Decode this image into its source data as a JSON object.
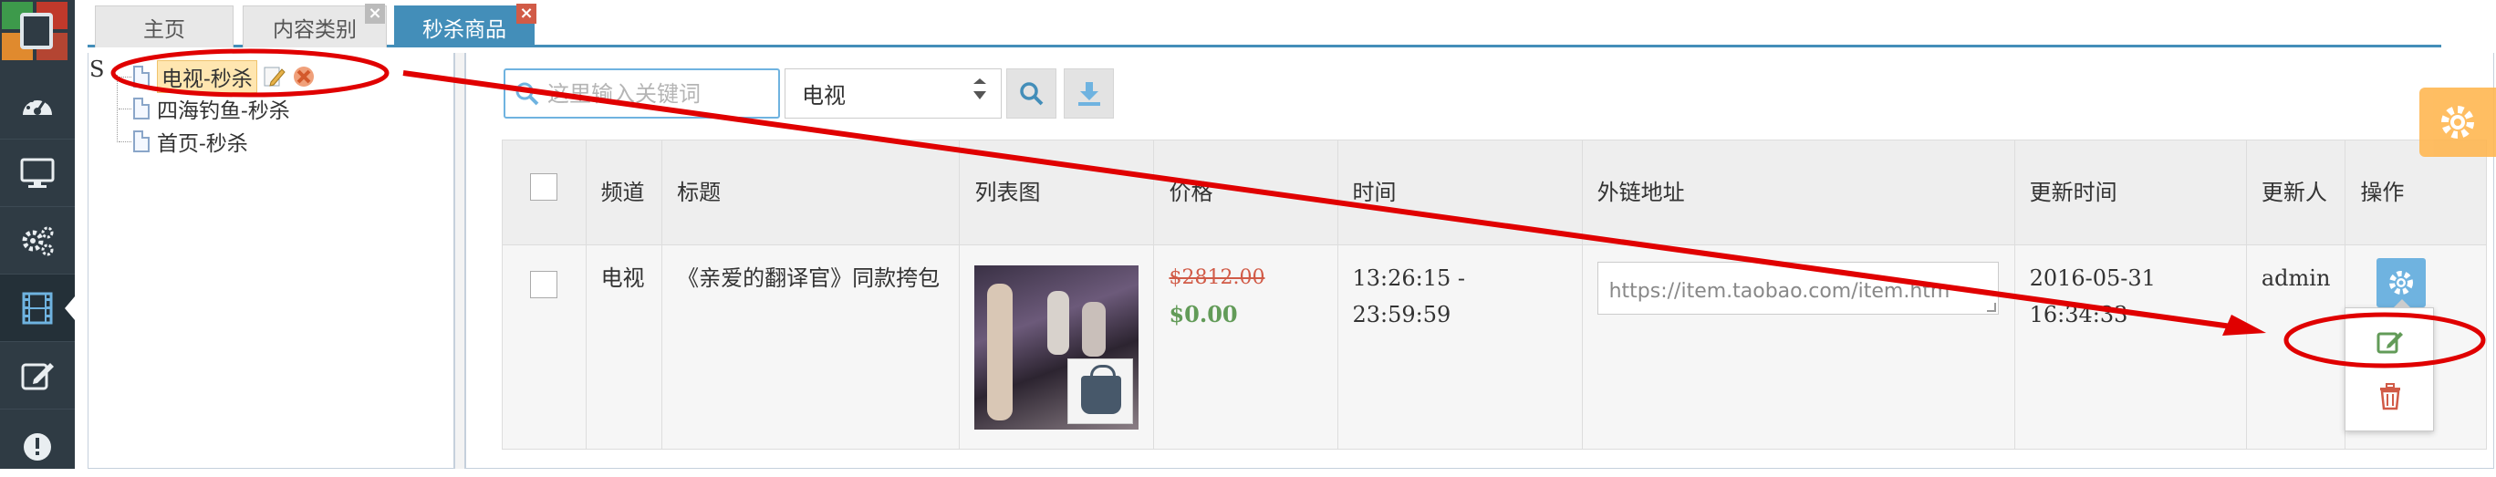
{
  "sidebar": {
    "icons": [
      "dashboard-icon",
      "monitor-icon",
      "gears-icon",
      "film-icon",
      "edit-icon",
      "exclamation-icon"
    ]
  },
  "tabs": [
    {
      "label": "主页"
    },
    {
      "label": "内容类别"
    },
    {
      "label": "秒杀商品"
    }
  ],
  "tree": {
    "root_label": "S",
    "nodes": [
      {
        "label": "电视-秒杀"
      },
      {
        "label": "四海钓鱼-秒杀"
      },
      {
        "label": "首页-秒杀"
      }
    ]
  },
  "toolbar": {
    "search_placeholder": "这里输入关键词",
    "channel_selected": "电视"
  },
  "table": {
    "headers": {
      "channel": "频道",
      "title": "标题",
      "image": "列表图",
      "price": "价格",
      "time": "时间",
      "link": "外链地址",
      "updated_at": "更新时间",
      "updated_by": "更新人",
      "actions": "操作"
    },
    "rows": [
      {
        "channel": "电视",
        "title": "《亲爱的翻译官》同款挎包",
        "old_price": "$2812.00",
        "new_price": "$0.00",
        "time": "13:26:15 - 23:59:59",
        "link": "https://item.taobao.com/item.htm",
        "updated_at": "2016-05-31 16:34:33",
        "updated_by": "admin"
      }
    ]
  },
  "colors": {
    "accent": "#438eb9",
    "annotation_red": "#e00000",
    "old_price": "#d15b47",
    "new_price": "#629b58",
    "settings_orange": "#ffb752"
  }
}
